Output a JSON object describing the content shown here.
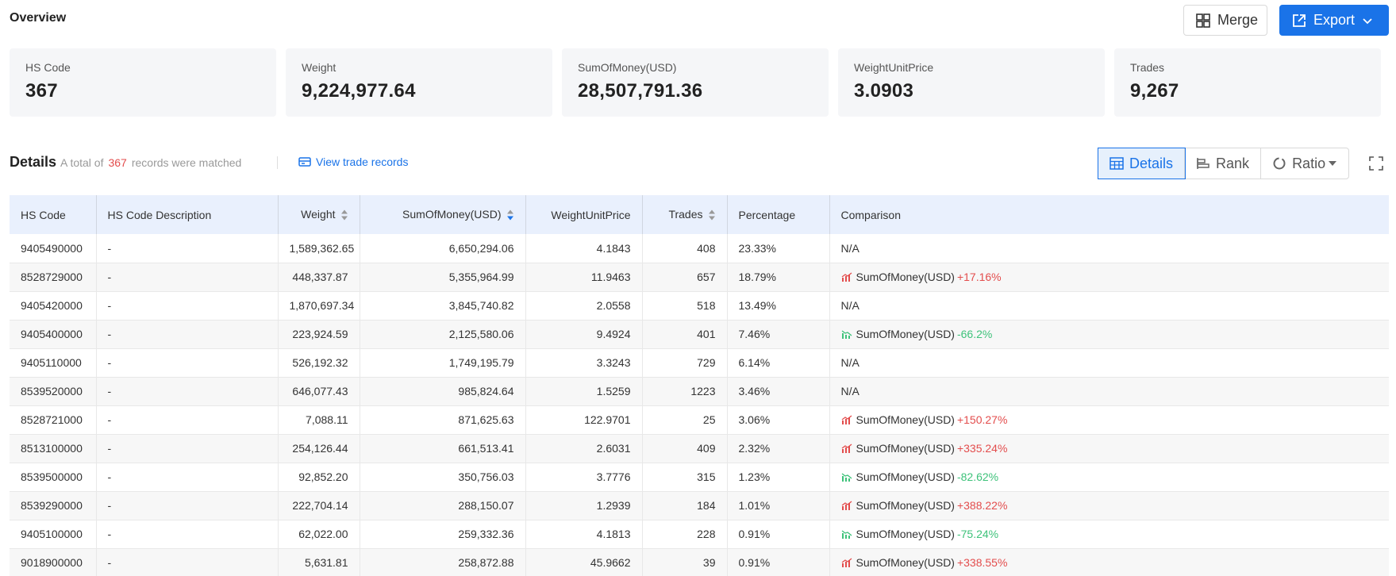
{
  "overview": {
    "title": "Overview",
    "merge_label": "Merge",
    "export_label": "Export"
  },
  "cards": [
    {
      "label": "HS Code",
      "value": "367"
    },
    {
      "label": "Weight",
      "value": "9,224,977.64"
    },
    {
      "label": "SumOfMoney(USD)",
      "value": "28,507,791.36"
    },
    {
      "label": "WeightUnitPrice",
      "value": "3.0903"
    },
    {
      "label": "Trades",
      "value": "9,267"
    }
  ],
  "details": {
    "title": "Details",
    "prefix": "A total of",
    "count": "367",
    "suffix": "records were matched",
    "view_link": "View trade records",
    "views": {
      "details": "Details",
      "rank": "Rank",
      "ratio": "Ratio"
    }
  },
  "table": {
    "headers": {
      "hs_code": "HS Code",
      "desc": "HS Code Description",
      "weight": "Weight",
      "money": "SumOfMoney(USD)",
      "unit_price": "WeightUnitPrice",
      "trades": "Trades",
      "percentage": "Percentage",
      "comparison": "Comparison"
    },
    "rows": [
      {
        "code": "9405490000",
        "desc": "-",
        "weight": "1,589,362.65",
        "money": "6,650,294.06",
        "price": "4.1843",
        "trades": "408",
        "pct": "23.33%",
        "cmp_text": "N/A",
        "cmp_change": "",
        "trend": "none"
      },
      {
        "code": "8528729000",
        "desc": "-",
        "weight": "448,337.87",
        "money": "5,355,964.99",
        "price": "11.9463",
        "trades": "657",
        "pct": "18.79%",
        "cmp_text": "SumOfMoney(USD)",
        "cmp_change": "+17.16%",
        "trend": "up"
      },
      {
        "code": "9405420000",
        "desc": "-",
        "weight": "1,870,697.34",
        "money": "3,845,740.82",
        "price": "2.0558",
        "trades": "518",
        "pct": "13.49%",
        "cmp_text": "N/A",
        "cmp_change": "",
        "trend": "none"
      },
      {
        "code": "9405400000",
        "desc": "-",
        "weight": "223,924.59",
        "money": "2,125,580.06",
        "price": "9.4924",
        "trades": "401",
        "pct": "7.46%",
        "cmp_text": "SumOfMoney(USD)",
        "cmp_change": "-66.2%",
        "trend": "down"
      },
      {
        "code": "9405110000",
        "desc": "-",
        "weight": "526,192.32",
        "money": "1,749,195.79",
        "price": "3.3243",
        "trades": "729",
        "pct": "6.14%",
        "cmp_text": "N/A",
        "cmp_change": "",
        "trend": "none"
      },
      {
        "code": "8539520000",
        "desc": "-",
        "weight": "646,077.43",
        "money": "985,824.64",
        "price": "1.5259",
        "trades": "1223",
        "pct": "3.46%",
        "cmp_text": "N/A",
        "cmp_change": "",
        "trend": "none"
      },
      {
        "code": "8528721000",
        "desc": "-",
        "weight": "7,088.11",
        "money": "871,625.63",
        "price": "122.9701",
        "trades": "25",
        "pct": "3.06%",
        "cmp_text": "SumOfMoney(USD)",
        "cmp_change": "+150.27%",
        "trend": "up"
      },
      {
        "code": "8513100000",
        "desc": "-",
        "weight": "254,126.44",
        "money": "661,513.41",
        "price": "2.6031",
        "trades": "409",
        "pct": "2.32%",
        "cmp_text": "SumOfMoney(USD)",
        "cmp_change": "+335.24%",
        "trend": "up"
      },
      {
        "code": "8539500000",
        "desc": "-",
        "weight": "92,852.20",
        "money": "350,756.03",
        "price": "3.7776",
        "trades": "315",
        "pct": "1.23%",
        "cmp_text": "SumOfMoney(USD)",
        "cmp_change": "-82.62%",
        "trend": "down"
      },
      {
        "code": "8539290000",
        "desc": "-",
        "weight": "222,704.14",
        "money": "288,150.07",
        "price": "1.2939",
        "trades": "184",
        "pct": "1.01%",
        "cmp_text": "SumOfMoney(USD)",
        "cmp_change": "+388.22%",
        "trend": "up"
      },
      {
        "code": "9405100000",
        "desc": "-",
        "weight": "62,022.00",
        "money": "259,332.36",
        "price": "4.1813",
        "trades": "228",
        "pct": "0.91%",
        "cmp_text": "SumOfMoney(USD)",
        "cmp_change": "-75.24%",
        "trend": "down"
      },
      {
        "code": "9018900000",
        "desc": "-",
        "weight": "5,631.81",
        "money": "258,872.88",
        "price": "45.9662",
        "trades": "39",
        "pct": "0.91%",
        "cmp_text": "SumOfMoney(USD)",
        "cmp_change": "+338.55%",
        "trend": "up"
      }
    ]
  },
  "colors": {
    "accent": "#1a73e8",
    "up": "#e34d4d",
    "down": "#3ec27a",
    "header_bg": "#e9f0fd"
  }
}
